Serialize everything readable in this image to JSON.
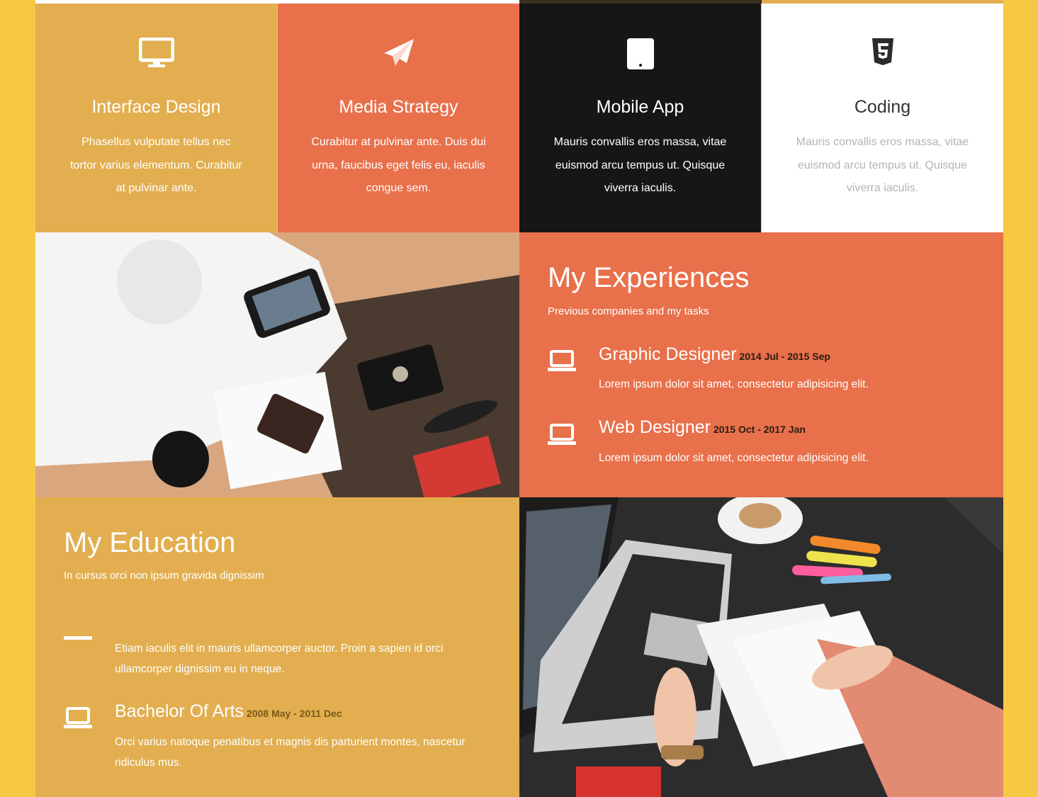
{
  "services": [
    {
      "title": "Interface Design",
      "desc": "Phasellus vulputate tellus nec tortor varius elementum. Curabitur at pulvinar ante.",
      "icon": "monitor-icon"
    },
    {
      "title": "Media Strategy",
      "desc": "Curabitur at pulvinar ante. Duis dui urna, faucibus eget felis eu, iaculis congue sem.",
      "icon": "paper-plane-icon"
    },
    {
      "title": "Mobile App",
      "desc": "Mauris convallis eros massa, vitae euismod arcu tempus ut. Quisque viverra iaculis.",
      "icon": "tablet-icon"
    },
    {
      "title": "Coding",
      "desc": "Mauris convallis eros massa, vitae euismod arcu tempus ut. Quisque viverra iaculis.",
      "icon": "html5-icon"
    }
  ],
  "experience": {
    "title": "My Experiences",
    "subtitle": "Previous companies and my tasks",
    "items": [
      {
        "title": "Graphic Designer",
        "date": "2014 Jul - 2015 Sep",
        "desc": "Lorem ipsum dolor sit amet, consectetur adipisicing elit."
      },
      {
        "title": "Web Designer",
        "date": "2015 Oct - 2017 Jan",
        "desc": "Lorem ipsum dolor sit amet, consectetur adipisicing elit."
      }
    ]
  },
  "education": {
    "title": "My Education",
    "subtitle": "In cursus orci non ipsum gravida dignissim",
    "items": [
      {
        "desc": "Etiam iaculis elit in mauris ullamcorper auctor. Proin a sapien id orci ullamcorper dignissim eu in neque."
      },
      {
        "title": "Bachelor Of Arts",
        "date": "2008 May - 2011 Dec",
        "desc": "Orci varius natoque penatibus et magnis dis parturient montes, nascetur ridiculus mus."
      }
    ]
  },
  "colors": {
    "page_bg": "#f7c843",
    "gold": "#e2ae4f",
    "orange": "#e8704a",
    "dark": "#161616",
    "white": "#ffffff"
  }
}
